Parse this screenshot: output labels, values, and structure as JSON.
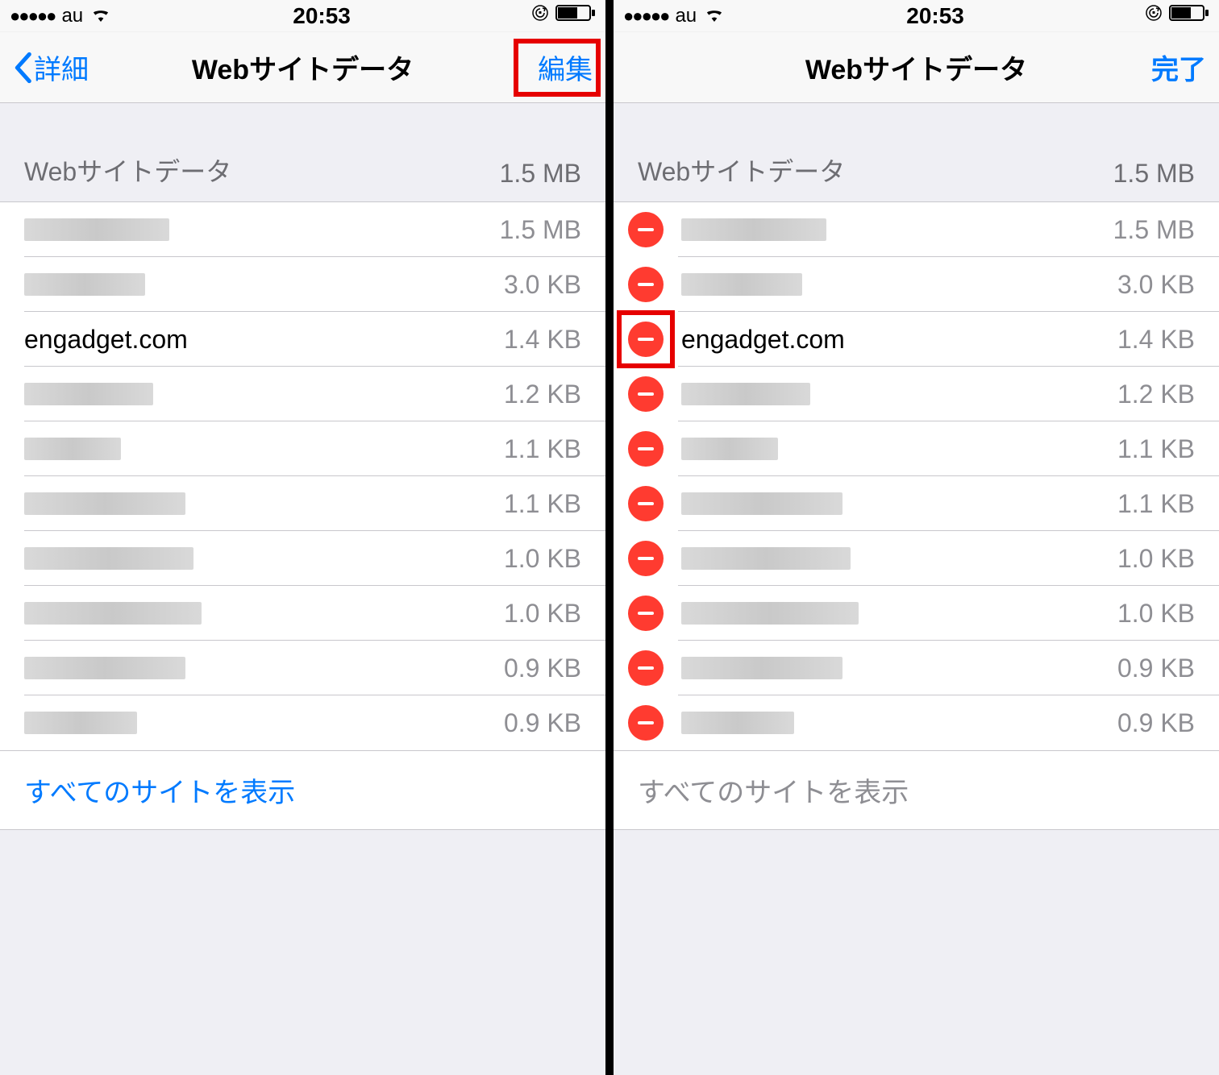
{
  "status": {
    "signal_dots": "●●●●●",
    "carrier": "au",
    "time": "20:53"
  },
  "left": {
    "nav": {
      "back": "詳細",
      "title": "Webサイトデータ",
      "action": "編集"
    },
    "section": {
      "label": "Webサイトデータ",
      "total": "1.5 MB"
    },
    "rows": [
      {
        "domain": null,
        "size": "1.5 MB",
        "redacted_w": 180
      },
      {
        "domain": null,
        "size": "3.0 KB",
        "redacted_w": 150
      },
      {
        "domain": "engadget.com",
        "size": "1.4 KB"
      },
      {
        "domain": null,
        "size": "1.2 KB",
        "redacted_w": 160
      },
      {
        "domain": null,
        "size": "1.1 KB",
        "redacted_w": 120
      },
      {
        "domain": null,
        "size": "1.1 KB",
        "redacted_w": 200
      },
      {
        "domain": null,
        "size": "1.0 KB",
        "redacted_w": 210
      },
      {
        "domain": null,
        "size": "1.0 KB",
        "redacted_w": 220
      },
      {
        "domain": null,
        "size": "0.9 KB",
        "redacted_w": 200
      },
      {
        "domain": null,
        "size": "0.9 KB",
        "redacted_w": 140
      }
    ],
    "footer": "すべてのサイトを表示"
  },
  "right": {
    "nav": {
      "title": "Webサイトデータ",
      "action": "完了"
    },
    "section": {
      "label": "Webサイトデータ",
      "total": "1.5 MB"
    },
    "rows": [
      {
        "domain": null,
        "size": "1.5 MB",
        "redacted_w": 180
      },
      {
        "domain": null,
        "size": "3.0 KB",
        "redacted_w": 150
      },
      {
        "domain": "engadget.com",
        "size": "1.4 KB",
        "highlight": true
      },
      {
        "domain": null,
        "size": "1.2 KB",
        "redacted_w": 160
      },
      {
        "domain": null,
        "size": "1.1 KB",
        "redacted_w": 120
      },
      {
        "domain": null,
        "size": "1.1 KB",
        "redacted_w": 200
      },
      {
        "domain": null,
        "size": "1.0 KB",
        "redacted_w": 210
      },
      {
        "domain": null,
        "size": "1.0 KB",
        "redacted_w": 220
      },
      {
        "domain": null,
        "size": "0.9 KB",
        "redacted_w": 200
      },
      {
        "domain": null,
        "size": "0.9 KB",
        "redacted_w": 140
      }
    ],
    "footer": "すべてのサイトを表示"
  }
}
